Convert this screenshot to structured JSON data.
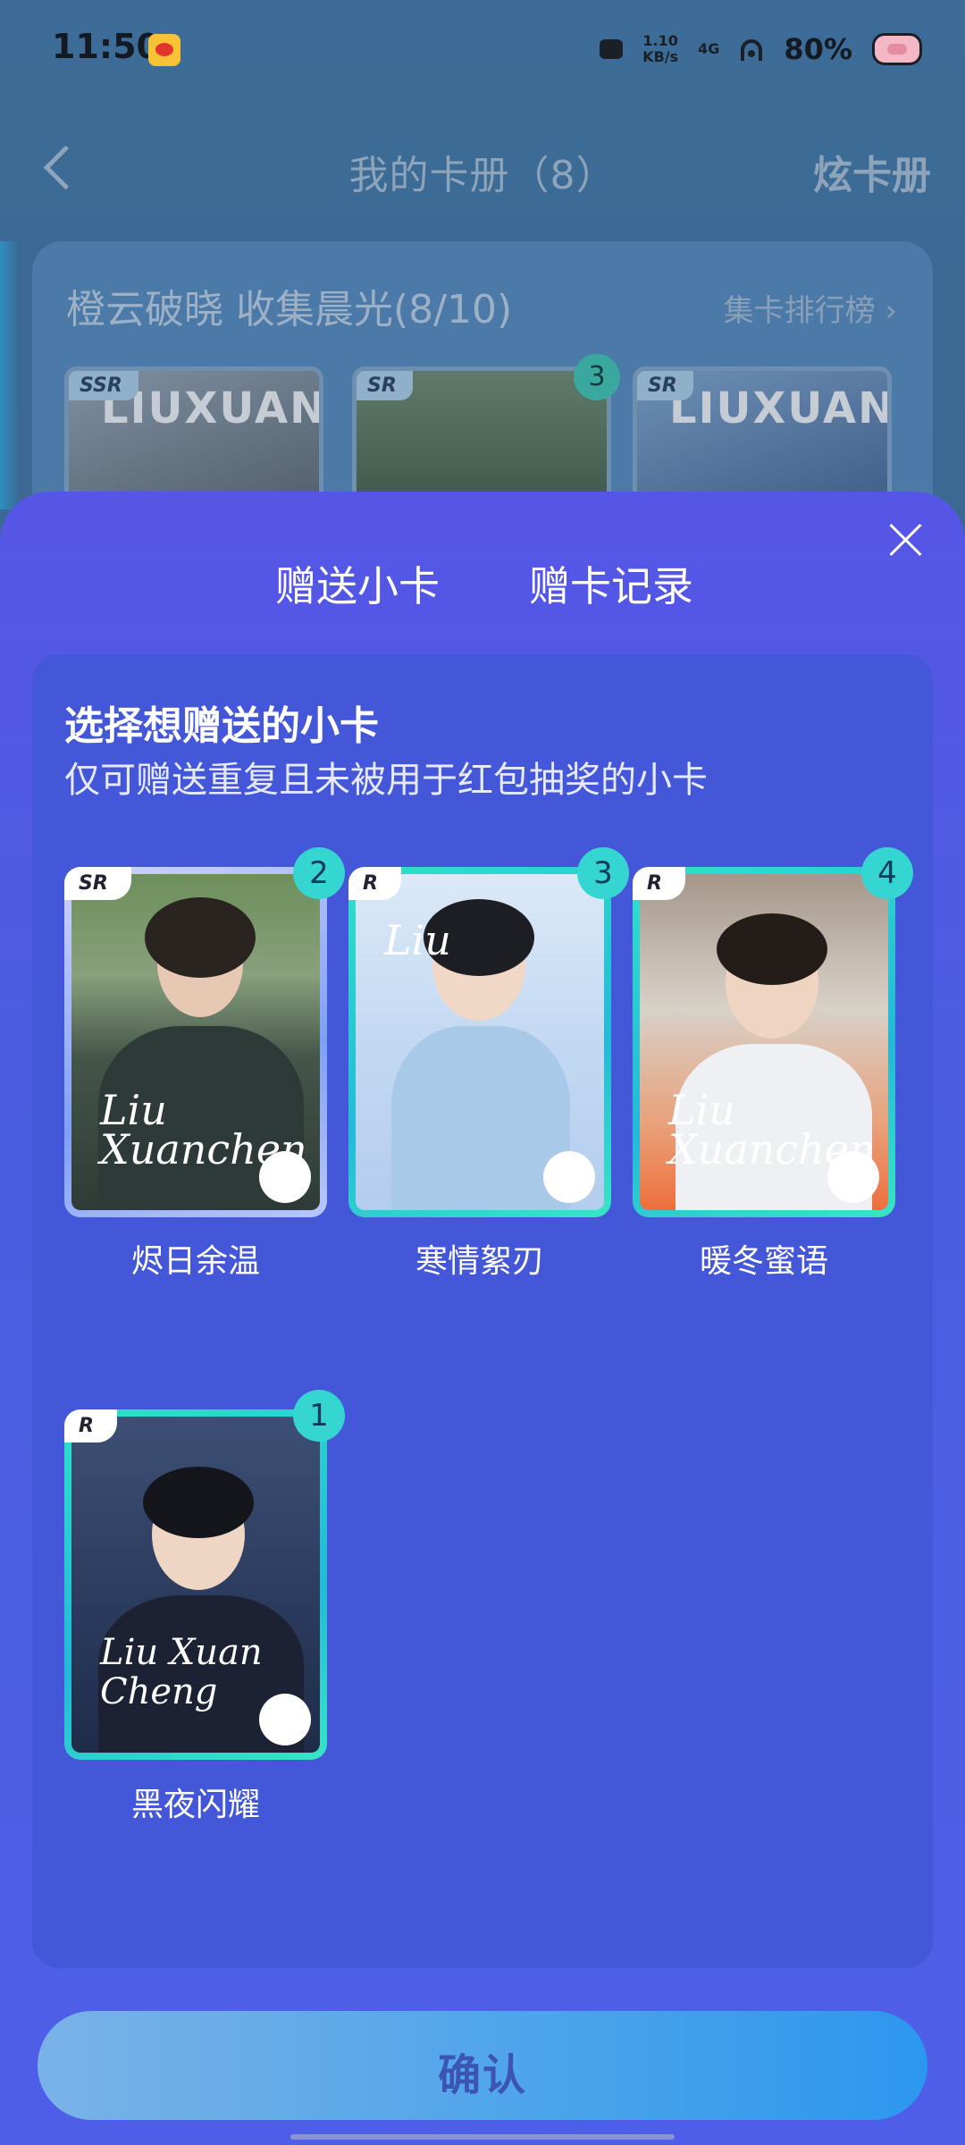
{
  "status_bar": {
    "time": "11:50",
    "net_speed_top": "1.10",
    "net_speed_bottom": "KB/s",
    "network": "4G",
    "battery": "80%"
  },
  "nav": {
    "title": "我的卡册（8）",
    "right_action": "炫卡册"
  },
  "collection": {
    "title": "橙云破晓 收集晨光(8/10)",
    "ranking_link": "集卡排行榜 ›",
    "thumbs": [
      {
        "rarity": "SSR",
        "text": "LIUXUAN"
      },
      {
        "rarity": "SR",
        "count": "3"
      },
      {
        "rarity": "SR",
        "text": "LIUXUAN"
      }
    ]
  },
  "sheet": {
    "tabs": [
      {
        "label": "赠送小卡"
      },
      {
        "label": "赠卡记录"
      }
    ],
    "heading": "选择想赠送的小卡",
    "subheading": "仅可赠送重复且未被用于红包抽奖的小卡",
    "cards": [
      {
        "name": "烬日余温",
        "rarity": "SR",
        "count": "2",
        "script": "Liu Xuanchen"
      },
      {
        "name": "寒情絮刃",
        "rarity": "R",
        "count": "3",
        "script": "Liu"
      },
      {
        "name": "暖冬蜜语",
        "rarity": "R",
        "count": "4",
        "script": "Liu Xuanchen"
      },
      {
        "name": "黑夜闪耀",
        "rarity": "R",
        "count": "1",
        "script": "Liu Xuan Cheng"
      }
    ],
    "confirm_label": "确认"
  }
}
